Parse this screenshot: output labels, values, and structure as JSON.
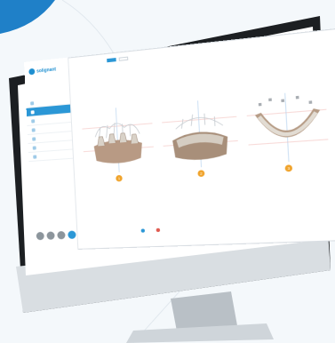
{
  "scene": {
    "colors": {
      "background": "#f4f8fb",
      "corner_blue": "#1f80c8",
      "monitor_frame": "#1c1f22",
      "stand_silver": "#c9cfd4",
      "accent_blue": "#2b97d6",
      "accent_orange": "#f0a32b",
      "accent_red": "#e05a4f"
    }
  },
  "app": {
    "logo_text": "solignant",
    "patient": {
      "line1": "",
      "line2": ""
    },
    "menu": [
      {
        "label": "",
        "active": false
      },
      {
        "label": "",
        "active": true
      },
      {
        "label": "",
        "active": false
      },
      {
        "label": "",
        "active": false
      },
      {
        "label": "",
        "active": false
      },
      {
        "label": "",
        "active": false
      },
      {
        "label": "",
        "active": false
      }
    ],
    "topbar": {
      "label": "",
      "seg_on": "",
      "seg_off": ""
    },
    "views": [
      {
        "number": "1"
      },
      {
        "number": "2"
      },
      {
        "number": "3"
      }
    ],
    "legend": [
      {
        "label": "",
        "color": "#2b97d6"
      },
      {
        "label": "",
        "color": "#e05a4f"
      }
    ]
  }
}
